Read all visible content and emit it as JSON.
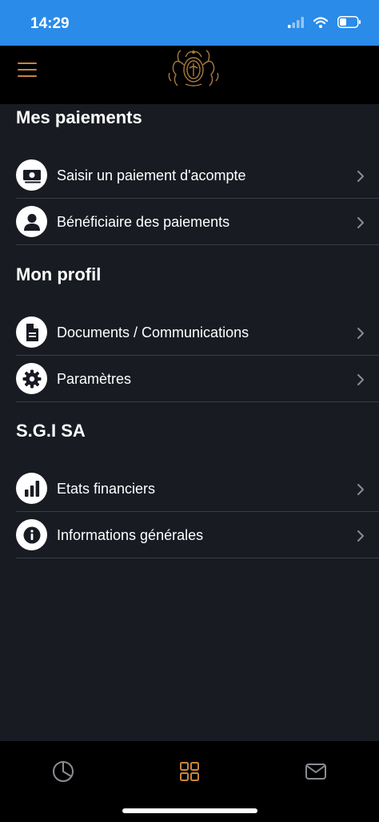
{
  "status_bar": {
    "time": "14:29",
    "background": "#2a8be8"
  },
  "header": {
    "menu_icon": "hamburger-menu-icon",
    "logo_icon": "ornate-crest-logo",
    "accent": "#c8853d"
  },
  "sections": [
    {
      "title": "Mes paiements",
      "items": [
        {
          "label": "Saisir un paiement d'acompte",
          "icon": "banknote-icon"
        },
        {
          "label": "Bénéficiaire des paiements",
          "icon": "user-icon"
        }
      ]
    },
    {
      "title": "Mon profil",
      "items": [
        {
          "label": "Documents / Communications",
          "icon": "document-icon"
        },
        {
          "label": "Paramètres",
          "icon": "gear-icon"
        }
      ]
    },
    {
      "title": "S.G.I SA",
      "items": [
        {
          "label": "Etats financiers",
          "icon": "bar-chart-icon"
        },
        {
          "label": "Informations générales",
          "icon": "info-icon"
        }
      ]
    }
  ],
  "bottom_nav": {
    "items": [
      {
        "icon": "pie-chart-icon",
        "active": false
      },
      {
        "icon": "grid-icon",
        "active": true
      },
      {
        "icon": "mail-icon",
        "active": false
      }
    ],
    "active_color": "#c8853d",
    "inactive_color": "#8a8d93"
  }
}
